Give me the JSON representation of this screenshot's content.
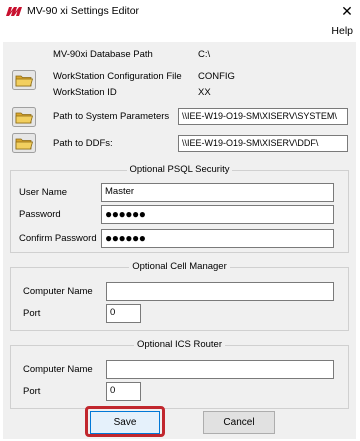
{
  "window": {
    "title": "MV-90 xi Settings Editor",
    "close_glyph": "✕"
  },
  "menu": {
    "help": "Help"
  },
  "colors": {
    "accent": "#0078d7",
    "highlight": "#c1272d",
    "logo": "#c8102e"
  },
  "settings": {
    "db_path_label": "MV-90xi Database Path",
    "db_path_value": "C:\\",
    "ws_config_label": "WorkStation Configuration File",
    "ws_config_value": "CONFIG",
    "ws_id_label": "WorkStation ID",
    "ws_id_value": "XX",
    "sys_params_label": "Path to System Parameters",
    "sys_params_value": "\\\\IEE-W19-O19-SM\\XISERV\\SYSTEM\\",
    "ddfs_label": "Path to DDFs:",
    "ddfs_value": "\\\\IEE-W19-O19-SM\\XISERV\\DDF\\"
  },
  "psql": {
    "title": "Optional PSQL Security",
    "user_name_label": "User Name",
    "user_name_value": "Master",
    "password_label": "Password",
    "password_value": "●●●●●●",
    "confirm_label": "Confirm Password",
    "confirm_value": "●●●●●●"
  },
  "cell_manager": {
    "title": "Optional Cell Manager",
    "computer_label": "Computer Name",
    "computer_value": "",
    "port_label": "Port",
    "port_value": "0"
  },
  "ics_router": {
    "title": "Optional ICS Router",
    "computer_label": "Computer Name",
    "computer_value": "",
    "port_label": "Port",
    "port_value": "0"
  },
  "buttons": {
    "save": "Save",
    "cancel": "Cancel"
  },
  "icons": {
    "folder": "folder-icon",
    "close": "close-icon",
    "logo": "app-logo-icon"
  }
}
